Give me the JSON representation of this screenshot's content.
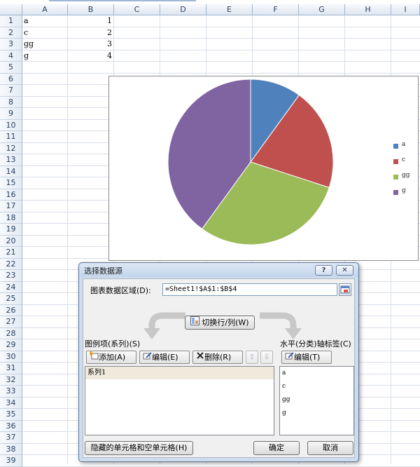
{
  "sheet": {
    "columns": [
      "A",
      "B",
      "C",
      "D",
      "E",
      "F",
      "G",
      "H",
      "I"
    ],
    "rows": [
      "1",
      "2",
      "3",
      "4",
      "5",
      "6",
      "7",
      "8",
      "9",
      "10",
      "11",
      "12",
      "13",
      "14",
      "15",
      "16",
      "17",
      "18",
      "19",
      "20",
      "21",
      "22",
      "23",
      "24",
      "25",
      "26",
      "27",
      "28",
      "29",
      "30",
      "31",
      "32",
      "33",
      "34",
      "35",
      "36",
      "37",
      "38",
      "39"
    ],
    "cells": [
      {
        "a": "a",
        "b": "1"
      },
      {
        "a": "c",
        "b": "2"
      },
      {
        "a": "gg",
        "b": "3"
      },
      {
        "a": "g",
        "b": "4"
      }
    ]
  },
  "chart_data": {
    "type": "pie",
    "categories": [
      "a",
      "c",
      "gg",
      "g"
    ],
    "values": [
      1,
      2,
      3,
      4
    ],
    "colors": [
      "#4f81bd",
      "#c0504d",
      "#9bbb59",
      "#8064a2"
    ],
    "legend_position": "right"
  },
  "dialog": {
    "title": "选择数据源",
    "help_label": "?",
    "close_label": "✕",
    "range_label": "图表数据区域(D):",
    "range_value": "=Sheet1!$A$1:$B$4",
    "switch_label": "切换行/列(W)",
    "series_label": "图例项(系列)(S)",
    "add_label": "添加(A)",
    "edit_label": "编辑(E)",
    "delete_label": "删除(R)",
    "up_label": "⇧",
    "down_label": "⇩",
    "series_items": [
      "系列1"
    ],
    "axis_label": "水平(分类)轴标签(C)",
    "axis_edit_label": "编辑(T)",
    "axis_items": [
      "a",
      "c",
      "gg",
      "g"
    ],
    "hidden_cells_label": "隐藏的单元格和空单元格(H)",
    "ok_label": "确定",
    "cancel_label": "取消"
  }
}
